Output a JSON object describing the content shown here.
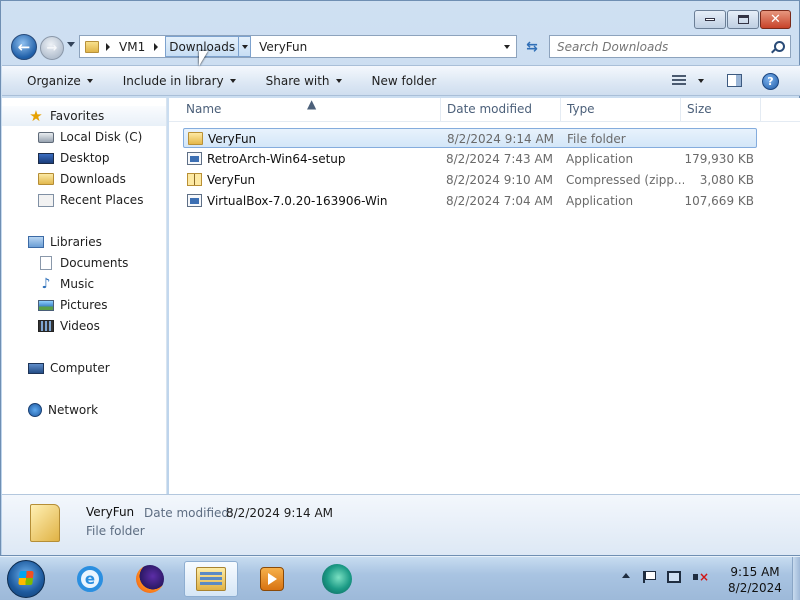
{
  "window": {
    "caption_buttons": [
      "minimize",
      "maximize",
      "close"
    ]
  },
  "address": {
    "crumbs": [
      "VM1",
      "Downloads",
      "VeryFun"
    ],
    "active_crumb": "Downloads"
  },
  "search": {
    "placeholder": "Search Downloads"
  },
  "toolbar": {
    "organize": "Organize",
    "include_in_library": "Include in library",
    "share_with": "Share with",
    "new_folder": "New folder"
  },
  "navpane": {
    "favorites": "Favorites",
    "favorites_items": [
      "Local Disk (C)",
      "Desktop",
      "Downloads",
      "Recent Places"
    ],
    "libraries": "Libraries",
    "libraries_items": [
      "Documents",
      "Music",
      "Pictures",
      "Videos"
    ],
    "computer": "Computer",
    "network": "Network"
  },
  "columns": {
    "name": "Name",
    "date_modified": "Date modified",
    "type": "Type",
    "size": "Size"
  },
  "files": [
    {
      "name": "VeryFun",
      "date": "8/2/2024 9:14 AM",
      "type": "File folder",
      "size": "",
      "icon": "folder-icon",
      "selected": true
    },
    {
      "name": "RetroArch-Win64-setup",
      "date": "8/2/2024 7:43 AM",
      "type": "Application",
      "size": "179,930 KB",
      "icon": "application-icon",
      "selected": false
    },
    {
      "name": "VeryFun",
      "date": "8/2/2024 9:10 AM",
      "type": "Compressed (zipp...",
      "size": "3,080 KB",
      "icon": "zip-folder-icon",
      "selected": false
    },
    {
      "name": "VirtualBox-7.0.20-163906-Win",
      "date": "8/2/2024 7:04 AM",
      "type": "Application",
      "size": "107,669 KB",
      "icon": "application-icon",
      "selected": false
    }
  ],
  "details": {
    "name": "VeryFun",
    "date_label": "Date modified:",
    "date_value": "8/2/2024 9:14 AM",
    "type": "File folder"
  },
  "taskbar": {
    "apps": [
      "internet-explorer-icon",
      "firefox-icon",
      "windows-explorer-icon",
      "media-player-icon",
      "virtualbox-icon"
    ],
    "active_app": "windows-explorer-icon",
    "clock_time": "9:15 AM",
    "clock_date": "8/2/2024"
  }
}
